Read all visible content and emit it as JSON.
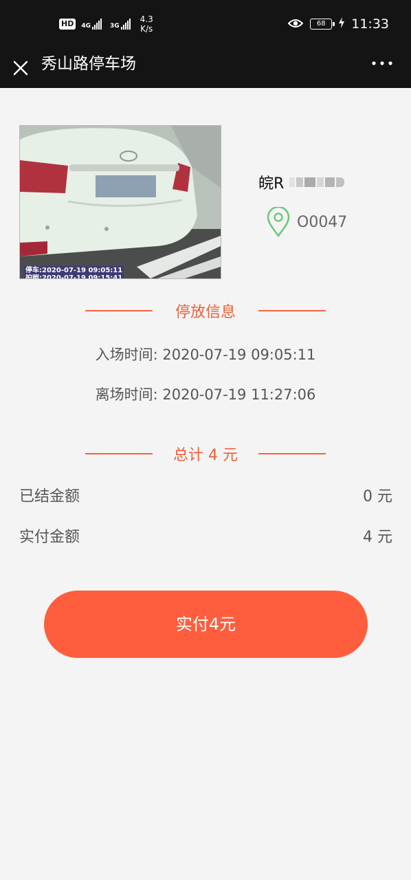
{
  "status_bar": {
    "hd_label": "HD",
    "sim1_type": "4G",
    "sim2_type": "3G",
    "signal1_level": 5,
    "signal2_level": 5,
    "net_speed_value": "4.3",
    "net_speed_unit": "K/s",
    "battery_percent": "68",
    "time": "11:33",
    "icons": [
      "hd-icon",
      "signal-icon",
      "eye-icon",
      "battery-icon",
      "charging-icon"
    ]
  },
  "nav": {
    "title": "秀山路停车场",
    "close_icon": "close-icon",
    "more_icon": "more-icon"
  },
  "vehicle": {
    "photo_caption_line1": "停车:2020-07-19 09:05:11",
    "photo_caption_line2": "拍照:2020-07-19 09:15:41",
    "plate_prefix": "皖R",
    "space_code": "O0047",
    "location_icon_color": "#6cc87a"
  },
  "parking_info": {
    "section_title": "停放信息",
    "entry_label": "入场时间:",
    "entry_time": "2020-07-19 09:05:11",
    "exit_label": "离场时间:",
    "exit_time": "2020-07-19 11:27:06"
  },
  "fees": {
    "total_title": "总计 4 元",
    "settled_label": "已结金额",
    "settled_value": "0 元",
    "paid_label": "实付金额",
    "paid_value": "4 元"
  },
  "action": {
    "pay_button_label": "实付4元"
  },
  "colors": {
    "accent": "#fe5e3d",
    "section_accent": "#ec5f37",
    "background": "#f4f4f4",
    "topbar": "#141414"
  }
}
